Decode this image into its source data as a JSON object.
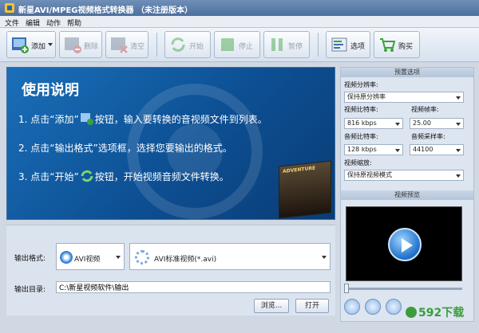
{
  "window": {
    "title": "新星AVI/MPEG视频格式转换器 （未注册版本）"
  },
  "menu": [
    "文件",
    "编辑",
    "动作",
    "帮助"
  ],
  "toolbar": {
    "add": "添加",
    "delete": "删除",
    "clear": "清空",
    "start": "开始",
    "stop": "停止",
    "pause": "暂停",
    "options": "选项",
    "buy": "购买"
  },
  "banner": {
    "heading": "使用说明",
    "step1_a": "1. 点击“添加”",
    "step1_b": "按钮，输入要转换的音视频文件到列表。",
    "step2": "2. 点击“输出格式”选项框，选择您要输出的格式。",
    "step3_a": "3. 点击“开始”",
    "step3_b": "按钮，开始视频音频文件转换。",
    "poster_text": "ADVENTURE"
  },
  "output": {
    "format_label": "输出格式:",
    "format_value": "AVI视频",
    "subformat_value": "AVI标准视频(*.avi)",
    "dir_label": "输出目录:",
    "dir_value": "C:\\新星视频软件\\输出",
    "browse": "浏览...",
    "open": "打开"
  },
  "settings": {
    "header": "预置选项",
    "resolution_label": "视频分辨率:",
    "resolution_value": "保持原分辨率",
    "vbitrate_label": "视频比特率:",
    "vbitrate_value": "816 kbps",
    "framerate_label": "视频帧率:",
    "framerate_value": "25.00",
    "abitrate_label": "音频比特率:",
    "abitrate_value": "128 kbps",
    "samplerate_label": "音频采样率:",
    "samplerate_value": "44100",
    "scale_label": "视频缩放:",
    "scale_value": "保持原视频模式"
  },
  "preview": {
    "header": "视频预览"
  },
  "watermark": "592下载",
  "colors": {
    "accent": "#1a6fb9",
    "titlebar": "#4d6f9d",
    "green": "#3c9c3c"
  }
}
